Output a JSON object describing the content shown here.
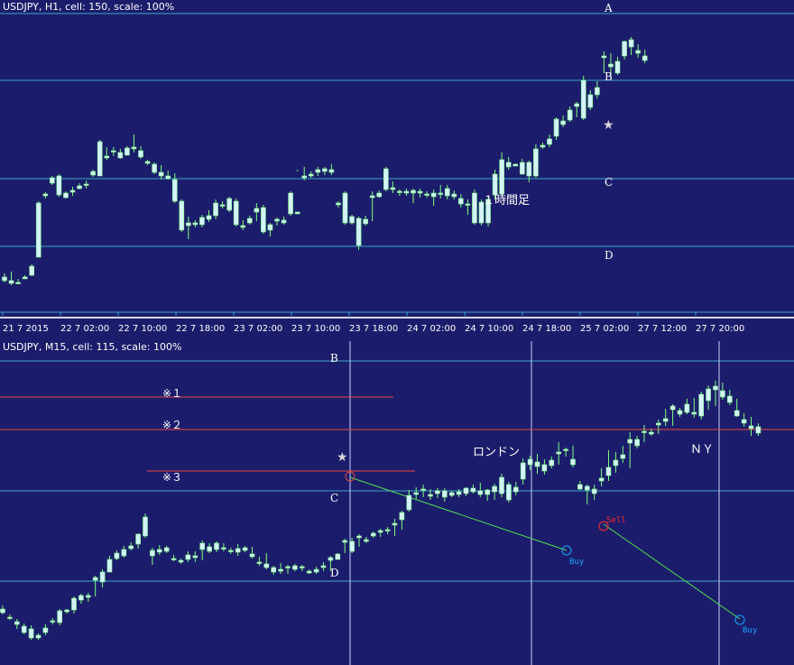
{
  "top_panel": {
    "header": "USDJPY, H1, cell: 150, scale: 100%",
    "level_labels": [
      "A",
      "B",
      "C",
      "D"
    ],
    "annotation": "１時間足",
    "star_glyph": "★",
    "x_tick_labels": [
      "21 7 2015",
      "22 7 02:00",
      "22 7 10:00",
      "22 7 18:00",
      "23 7 02:00",
      "23 7 10:00",
      "23 7 18:00",
      "24 7 02:00",
      "24 7 10:00",
      "24 7 18:00",
      "25 7 02:00",
      "27 7 12:00",
      "27 7 20:00"
    ]
  },
  "bottom_panel": {
    "header": "USDJPY, M15, cell: 115, scale: 100%",
    "level_labels": [
      "B",
      "C",
      "D"
    ],
    "resistance_labels": [
      "※１",
      "※２",
      "※３"
    ],
    "session_labels": [
      "ロンドン",
      "ＮＹ"
    ],
    "star_glyph": "★",
    "signals": [
      {
        "label": "Buy",
        "color": "#19a6ff"
      },
      {
        "label": "Sell",
        "color": "#ff2a2a"
      },
      {
        "label": "Buy",
        "color": "#19a6ff"
      }
    ]
  },
  "colors": {
    "background": "#1c1c6c",
    "level_line": "#3aa8c8",
    "separator": "#d7d7ff",
    "candle": "#d6f2ff",
    "wick": "#7dff7d",
    "resistance_line": "#e84a3a",
    "trend_line": "#4ddf4d",
    "text": "#ffffff",
    "session_line": "#d0d0ff"
  },
  "chart_data": [
    {
      "type": "candlestick",
      "title": "USDJPY, H1, cell: 150, scale: 100%",
      "x_tick_labels": [
        "21 7 2015",
        "22 7 02:00",
        "22 7 10:00",
        "22 7 18:00",
        "23 7 02:00",
        "23 7 10:00",
        "23 7 18:00",
        "24 7 02:00",
        "24 7 10:00",
        "24 7 18:00",
        "25 7 02:00",
        "27 7 12:00",
        "27 7 20:00"
      ],
      "levels": [
        "A",
        "B",
        "C",
        "D"
      ],
      "ohlc": [
        [
          38,
          32,
          42,
          34
        ],
        [
          34,
          29,
          44,
          31
        ],
        [
          31,
          30,
          36,
          32
        ],
        [
          36,
          36,
          40,
          38
        ],
        [
          40,
          39,
          52,
          50
        ],
        [
          60,
          60,
          122,
          120
        ],
        [
          128,
          125,
          132,
          130
        ],
        [
          142,
          140,
          150,
          148
        ],
        [
          150,
          127,
          152,
          129
        ],
        [
          126,
          125,
          133,
          131
        ],
        [
          132,
          128,
          138,
          134
        ],
        [
          136,
          135,
          142,
          139
        ],
        [
          141,
          136,
          145,
          140
        ],
        [
          151,
          149,
          157,
          155
        ],
        [
          150,
          150,
          190,
          188
        ],
        [
          170,
          168,
          182,
          172
        ],
        [
          177,
          172,
          182,
          178
        ],
        [
          170,
          169,
          180,
          176
        ],
        [
          173,
          173,
          183,
          181
        ],
        [
          182,
          176,
          196,
          180
        ],
        [
          171,
          169,
          183,
          178
        ],
        [
          164,
          162,
          168,
          166
        ],
        [
          163,
          152,
          165,
          154
        ],
        [
          154,
          146,
          162,
          150
        ],
        [
          147,
          146,
          156,
          150
        ],
        [
          146,
          120,
          153,
          122
        ],
        [
          122,
          88,
          124,
          90
        ],
        [
          95,
          80,
          105,
          98
        ],
        [
          98,
          93,
          101,
          96
        ],
        [
          104,
          93,
          107,
          96
        ],
        [
          106,
          99,
          112,
          102
        ],
        [
          120,
          102,
          124,
          106
        ],
        [
          117,
          114,
          122,
          118
        ],
        [
          125,
          110,
          127,
          112
        ],
        [
          122,
          94,
          125,
          96
        ],
        [
          93,
          90,
          101,
          95
        ],
        [
          103,
          96,
          106,
          98
        ],
        [
          114,
          100,
          120,
          110
        ],
        [
          115,
          86,
          118,
          88
        ],
        [
          90,
          83,
          98,
          96
        ],
        [
          102,
          95,
          104,
          100
        ],
        [
          101,
          96,
          105,
          98
        ],
        [
          131,
          106,
          133,
          108
        ],
        [
          108,
          155,
          157,
          110
        ],
        [
          150,
          145,
          160,
          148
        ],
        [
          150,
          148,
          155,
          152
        ],
        [
          154,
          150,
          160,
          157
        ],
        [
          155,
          151,
          160,
          158
        ],
        [
          157,
          151,
          163,
          154
        ],
        [
          118,
          115,
          122,
          120
        ],
        [
          131,
          96,
          133,
          98
        ],
        [
          98,
          96,
          107,
          105
        ],
        [
          73,
          68,
          105,
          103
        ],
        [
          102,
          95,
          106,
          97
        ],
        [
          128,
          100,
          133,
          126
        ],
        [
          127,
          126,
          134,
          131
        ],
        [
          158,
          133,
          160,
          135
        ],
        [
          137,
          131,
          144,
          135
        ],
        [
          133,
          128,
          135,
          132
        ],
        [
          131,
          128,
          136,
          133
        ],
        [
          131,
          120,
          136,
          134
        ],
        [
          131,
          126,
          136,
          133
        ],
        [
          129,
          126,
          133,
          130
        ],
        [
          127,
          117,
          135,
          131
        ],
        [
          131,
          125,
          140,
          130
        ],
        [
          136,
          124,
          140,
          128
        ],
        [
          127,
          124,
          134,
          130
        ],
        [
          125,
          115,
          130,
          119
        ],
        [
          118,
          107,
          124,
          119
        ],
        [
          131,
          96,
          135,
          98
        ],
        [
          98,
          95,
          124,
          121
        ],
        [
          98,
          94,
          126,
          124
        ],
        [
          152,
          124,
          157,
          129
        ],
        [
          168,
          128,
          176,
          130
        ],
        [
          165,
          157,
          171,
          160
        ],
        [
          161,
          161,
          164,
          163
        ],
        [
          152,
          152,
          169,
          165
        ],
        [
          150,
          143,
          167,
          165
        ],
        [
          180,
          148,
          185,
          150
        ],
        [
          184,
          180,
          187,
          182
        ],
        [
          191,
          182,
          196,
          185
        ],
        [
          194,
          190,
          215,
          213
        ],
        [
          211,
          204,
          217,
          207
        ],
        [
          223,
          210,
          227,
          212
        ],
        [
          227,
          215,
          232,
          230
        ],
        [
          256,
          212,
          261,
          214
        ],
        [
          240,
          223,
          245,
          226
        ],
        [
          248,
          236,
          255,
          240
        ],
        [
          283,
          264,
          288,
          281
        ],
        [
          274,
          259,
          286,
          271
        ],
        [
          277,
          262,
          282,
          264
        ],
        [
          283,
          279,
          300,
          299
        ],
        [
          293,
          284,
          304,
          301
        ],
        [
          289,
          281,
          296,
          286
        ],
        [
          283,
          275,
          290,
          278
        ]
      ]
    },
    {
      "type": "candlestick",
      "title": "USDJPY, M15, cell: 115, scale: 100%",
      "levels": [
        "B",
        "C",
        "D"
      ],
      "annotations": [
        "※１",
        "※２",
        "※３",
        "ロンドン",
        "ＮＹ"
      ],
      "signals": [
        "Buy",
        "Sell",
        "Buy"
      ],
      "ohlc": [
        [
          58,
          56,
          66,
          62
        ],
        [
          53,
          50,
          56,
          52
        ],
        [
          45,
          40,
          51,
          48
        ],
        [
          43,
          34,
          46,
          36
        ],
        [
          40,
          28,
          44,
          30
        ],
        [
          30,
          28,
          35,
          33
        ],
        [
          41,
          33,
          45,
          36
        ],
        [
          49,
          45,
          52,
          48
        ],
        [
          47,
          44,
          62,
          60
        ],
        [
          59,
          57,
          62,
          61
        ],
        [
          61,
          57,
          76,
          74
        ],
        [
          72,
          68,
          79,
          77
        ],
        [
          77,
          70,
          80,
          75
        ],
        [
          94,
          76,
          99,
          97
        ],
        [
          92,
          86,
          106,
          103
        ],
        [
          103,
          104,
          121,
          117
        ],
        [
          118,
          116,
          127,
          124
        ],
        [
          128,
          119,
          132,
          121
        ],
        [
          132,
          127,
          136,
          129
        ],
        [
          134,
          129,
          146,
          145
        ],
        [
          164,
          141,
          168,
          143
        ],
        [
          121,
          111,
          130,
          127
        ],
        [
          125,
          122,
          133,
          128
        ],
        [
          130,
          124,
          132,
          126
        ],
        [
          117,
          115,
          122,
          118
        ],
        [
          114,
          112,
          118,
          116
        ],
        [
          117,
          114,
          126,
          122
        ],
        [
          121,
          114,
          126,
          119
        ],
        [
          128,
          116,
          138,
          135
        ],
        [
          131,
          124,
          135,
          126
        ],
        [
          128,
          125,
          137,
          135
        ],
        [
          130,
          126,
          135,
          129
        ],
        [
          126,
          123,
          130,
          127
        ],
        [
          125,
          121,
          134,
          129
        ],
        [
          127,
          125,
          132,
          130
        ],
        [
          120,
          118,
          131,
          123
        ],
        [
          113,
          110,
          120,
          114
        ],
        [
          108,
          106,
          124,
          112
        ],
        [
          103,
          100,
          110,
          108
        ],
        [
          106,
          101,
          113,
          104
        ],
        [
          109,
          101,
          111,
          109
        ],
        [
          106,
          104,
          112,
          110
        ],
        [
          109,
          104,
          111,
          108
        ],
        [
          102,
          101,
          106,
          104
        ],
        [
          106,
          101,
          109,
          103
        ],
        [
          110,
          104,
          114,
          108
        ],
        [
          116,
          104,
          121,
          119
        ],
        [
          117,
          117,
          124,
          123
        ],
        [
          138,
          124,
          140,
          136
        ],
        [
          137,
          124,
          141,
          126
        ],
        [
          141,
          131,
          145,
          143
        ],
        [
          139,
          135,
          142,
          137
        ],
        [
          146,
          141,
          148,
          143
        ],
        [
          149,
          142,
          151,
          147
        ],
        [
          149,
          145,
          153,
          150
        ],
        [
          157,
          143,
          162,
          155
        ],
        [
          161,
          150,
          171,
          169
        ],
        [
          172,
          170,
          194,
          188
        ],
        [
          191,
          184,
          197,
          189
        ],
        [
          194,
          186,
          200,
          195
        ],
        [
          189,
          183,
          195,
          187
        ],
        [
          193,
          185,
          196,
          190
        ],
        [
          186,
          181,
          196,
          193
        ],
        [
          188,
          186,
          193,
          191
        ],
        [
          189,
          186,
          195,
          192
        ],
        [
          190,
          187,
          197,
          196
        ],
        [
          196,
          190,
          200,
          192
        ],
        [
          193,
          186,
          202,
          189
        ],
        [
          189,
          182,
          195,
          194
        ],
        [
          192,
          183,
          201,
          198
        ],
        [
          208,
          186,
          212,
          190
        ],
        [
          183,
          180,
          203,
          200
        ],
        [
          197,
          188,
          203,
          192
        ],
        [
          206,
          200,
          229,
          224
        ],
        [
          222,
          216,
          232,
          228
        ],
        [
          225,
          212,
          234,
          220
        ],
        [
          215,
          211,
          228,
          222
        ],
        [
          221,
          218,
          231,
          227
        ],
        [
          236,
          222,
          247,
          234
        ],
        [
          239,
          231,
          241,
          238
        ],
        [
          228,
          219,
          243,
          222
        ],
        [
          195,
          194,
          204,
          200
        ],
        [
          194,
          178,
          200,
          198
        ],
        [
          195,
          183,
          200,
          190
        ],
        [
          207,
          198,
          218,
          204
        ],
        [
          210,
          204,
          238,
          219
        ],
        [
          221,
          213,
          236,
          227
        ],
        [
          233,
          224,
          243,
          229
        ],
        [
          246,
          218,
          258,
          250
        ],
        [
          250,
          240,
          254,
          243
        ],
        [
          259,
          247,
          266,
          258
        ],
        [
          258,
          254,
          262,
          256
        ],
        [
          266,
          256,
          272,
          268
        ],
        [
          273,
          265,
          284,
          270
        ],
        [
          283,
          265,
          289,
          287
        ],
        [
          282,
          275,
          285,
          278
        ],
        [
          289,
          278,
          295,
          280
        ],
        [
          280,
          274,
          296,
          278
        ],
        [
          300,
          272,
          303,
          276
        ],
        [
          306,
          283,
          310,
          293
        ],
        [
          305,
          287,
          315,
          309
        ],
        [
          304,
          294,
          313,
          297
        ],
        [
          298,
          288,
          305,
          291
        ],
        [
          282,
          275,
          295,
          276
        ],
        [
          268,
          264,
          279,
          272
        ],
        [
          262,
          254,
          275,
          265
        ],
        [
          257,
          254,
          268,
          264
        ]
      ]
    }
  ]
}
